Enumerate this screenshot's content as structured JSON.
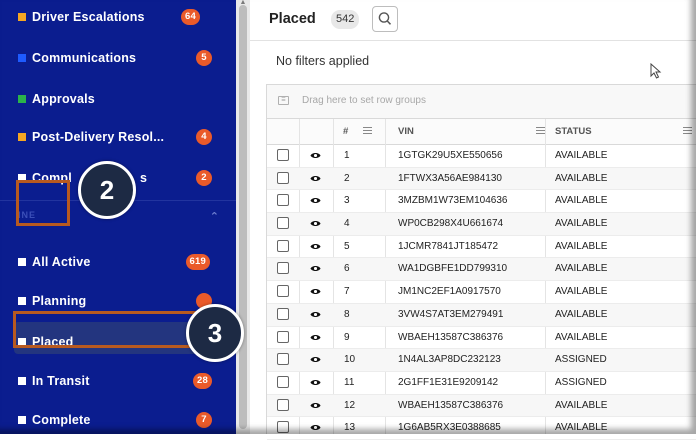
{
  "sidebar": {
    "items": [
      {
        "label": "Driver Escalations",
        "badge": "64",
        "color": "#f5a623"
      },
      {
        "label": "Communications",
        "badge": "5",
        "color": "#1e5bff"
      },
      {
        "label": "Approvals",
        "badge": "",
        "color": "#2bb34a"
      },
      {
        "label": "Post-Delivery Resol...",
        "badge": "4",
        "color": "#f5a623"
      },
      {
        "label": "Compl",
        "label_tail": "s",
        "badge": "2",
        "color": "#ffffff"
      },
      {
        "label": "All Active",
        "badge": "619",
        "color": "#ffffff"
      },
      {
        "label": "Planning",
        "badge": "",
        "color": "#ffffff"
      },
      {
        "label": "Placed",
        "badge": "",
        "color": "#ffffff"
      },
      {
        "label": "In Transit",
        "badge": "28",
        "color": "#ffffff"
      },
      {
        "label": "Complete",
        "badge": "7",
        "color": "#ffffff"
      }
    ],
    "group_header": "INE",
    "accent_badge_color": "#ea5a2a"
  },
  "main": {
    "title": "Placed",
    "count": "542",
    "search_icon": "search-icon",
    "filters_text": "No filters applied",
    "group_bar_text": "Drag here to set row groups",
    "columns": {
      "num": "#",
      "vin": "VIN",
      "status": "STATUS"
    },
    "rows": [
      {
        "n": "1",
        "vin": "1GTGK29U5XE550656",
        "status": "AVAILABLE"
      },
      {
        "n": "2",
        "vin": "1FTWX3A56AE984130",
        "status": "AVAILABLE"
      },
      {
        "n": "3",
        "vin": "3MZBM1W73EM104636",
        "status": "AVAILABLE"
      },
      {
        "n": "4",
        "vin": "WP0CB298X4U661674",
        "status": "AVAILABLE"
      },
      {
        "n": "5",
        "vin": "1JCMR7841JT185472",
        "status": "AVAILABLE"
      },
      {
        "n": "6",
        "vin": "WA1DGBFE1DD799310",
        "status": "AVAILABLE"
      },
      {
        "n": "7",
        "vin": "JM1NC2EF1A0917570",
        "status": "AVAILABLE"
      },
      {
        "n": "8",
        "vin": "3VW4S7AT3EM279491",
        "status": "AVAILABLE"
      },
      {
        "n": "9",
        "vin": "WBAEH13587C386376",
        "status": "AVAILABLE"
      },
      {
        "n": "10",
        "vin": "1N4AL3AP8DC232123",
        "status": "ASSIGNED"
      },
      {
        "n": "11",
        "vin": "2G1FF1E31E9209142",
        "status": "ASSIGNED"
      },
      {
        "n": "12",
        "vin": "WBAEH13587C386376",
        "status": "AVAILABLE"
      },
      {
        "n": "13",
        "vin": "1G6AB5RX3E0388685",
        "status": "AVAILABLE"
      }
    ]
  },
  "callouts": [
    {
      "number": "2"
    },
    {
      "number": "3"
    }
  ]
}
